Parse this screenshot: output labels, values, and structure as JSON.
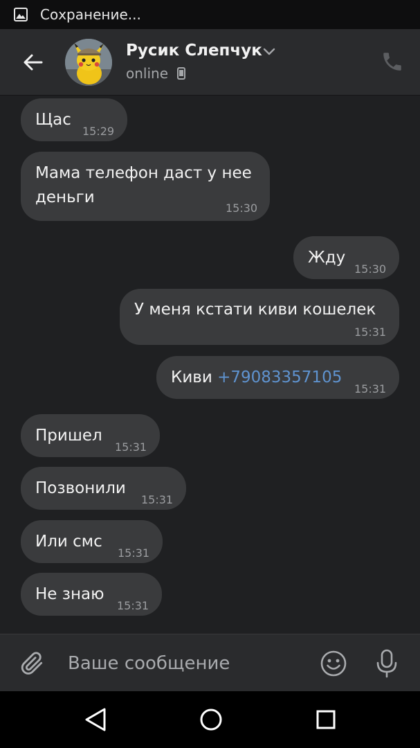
{
  "status_bar": {
    "text": "Сохранение..."
  },
  "header": {
    "contact_name": "Русик Слепчук",
    "status": "online"
  },
  "messages": [
    {
      "direction": "in",
      "text": "Щас",
      "time": "15:29"
    },
    {
      "direction": "in",
      "text_line1": "Мама телефон даст у нее",
      "text_line2": "деньги",
      "time": "15:30"
    },
    {
      "direction": "out",
      "text": "Жду",
      "time": "15:30"
    },
    {
      "direction": "out",
      "text": "У меня кстати киви кошелек",
      "time": "15:31"
    },
    {
      "direction": "out",
      "text": "Киви ",
      "link": "+79083357105",
      "time": "15:31"
    },
    {
      "direction": "in",
      "text": "Пришел",
      "time": "15:31"
    },
    {
      "direction": "in",
      "text": "Позвонили",
      "time": "15:31"
    },
    {
      "direction": "in",
      "text": "Или смс",
      "time": "15:31"
    },
    {
      "direction": "in",
      "text": "Не знаю",
      "time": "15:31"
    }
  ],
  "composer": {
    "placeholder": "Ваше сообщение"
  },
  "colors": {
    "background": "#1f2022",
    "header": "#2a2b2d",
    "bubble": "#3a3b3d",
    "link": "#5f93cf",
    "time": "#9b9da0"
  },
  "icons": [
    "image-icon",
    "back-arrow-icon",
    "chevron-down-icon",
    "phone-small-icon",
    "phone-call-icon",
    "paperclip-icon",
    "smiley-icon",
    "microphone-icon",
    "nav-back-icon",
    "nav-home-icon",
    "nav-recent-icon"
  ]
}
